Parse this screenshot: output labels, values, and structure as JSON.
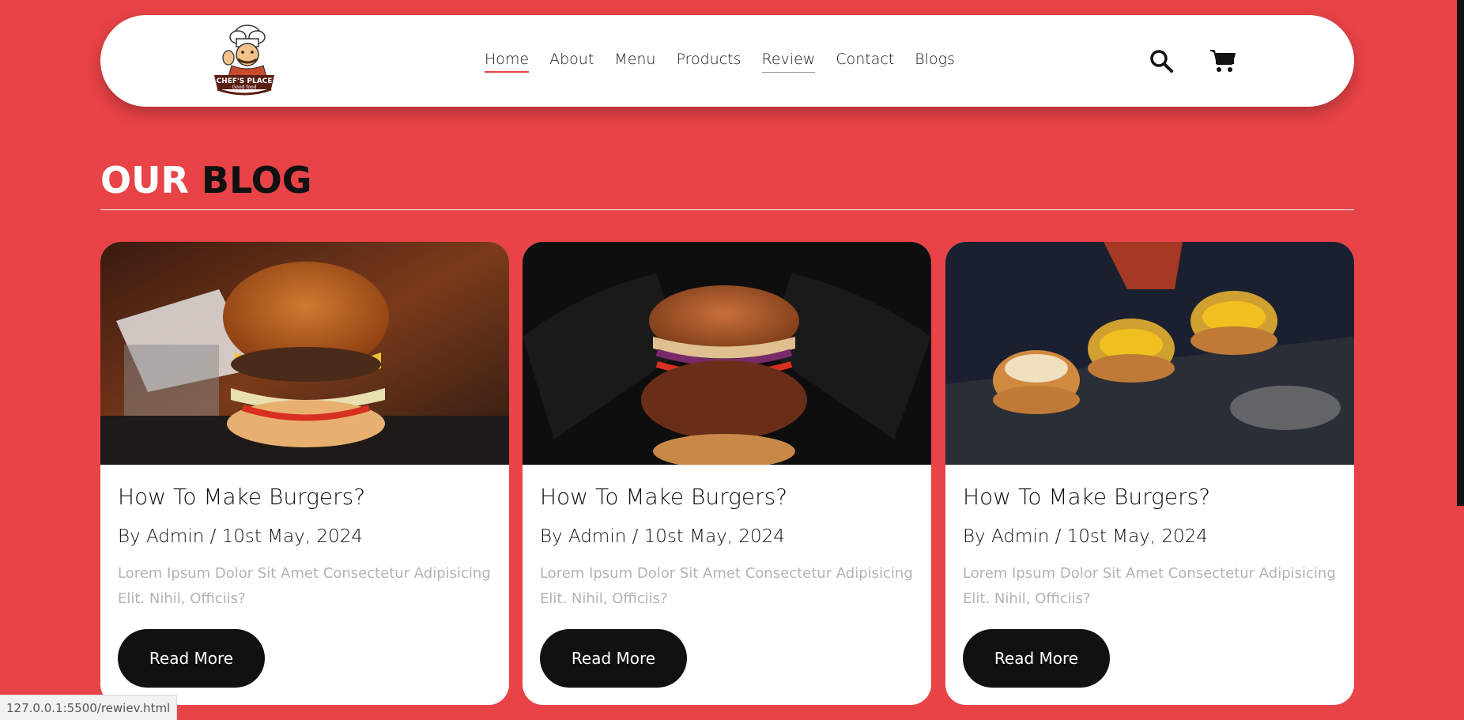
{
  "header": {
    "logo": {
      "name": "CHEF'S PLACE",
      "tagline": "Good food"
    },
    "nav": [
      {
        "label": "Home",
        "state": "active"
      },
      {
        "label": "About"
      },
      {
        "label": "Menu"
      },
      {
        "label": "Products"
      },
      {
        "label": "Review",
        "state": "hovered"
      },
      {
        "label": "Contact"
      },
      {
        "label": "Blogs"
      }
    ],
    "icons": {
      "search": "search-icon",
      "cart": "cart-icon"
    }
  },
  "section": {
    "title_part1": "OUR",
    "title_part2": "BLOG"
  },
  "cards": [
    {
      "title": "How To Make Burgers?",
      "meta": "By Admin / 10st May, 2024",
      "desc": "Lorem Ipsum Dolor Sit Amet Consectetur Adipisicing Elit. Nihil, Officiis?",
      "button": "Read More"
    },
    {
      "title": "How To Make Burgers?",
      "meta": "By Admin / 10st May, 2024",
      "desc": "Lorem Ipsum Dolor Sit Amet Consectetur Adipisicing Elit. Nihil, Officiis?",
      "button": "Read More"
    },
    {
      "title": "How To Make Burgers?",
      "meta": "By Admin / 10st May, 2024",
      "desc": "Lorem Ipsum Dolor Sit Amet Consectetur Adipisicing Elit. Nihil, Officiis?",
      "button": "Read More"
    }
  ],
  "status_bar": {
    "url": "127.0.0.1:5500/rewiev.html"
  },
  "colors": {
    "accent": "#e84346",
    "button": "#111111",
    "muted_text": "#b3b3b3"
  }
}
